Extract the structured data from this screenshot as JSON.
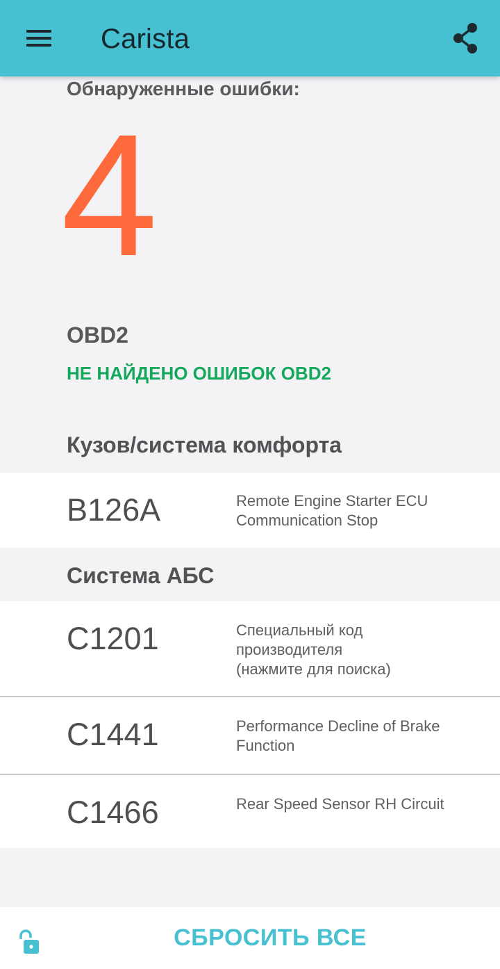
{
  "app": {
    "title": "Carista",
    "menu_icon": "hamburger-menu-icon",
    "share_icon": "share-icon",
    "accent_color": "#47c1d1"
  },
  "summary": {
    "found_label": "Обнаруженные ошибки:",
    "count": "4",
    "count_color": "#ff6a3d"
  },
  "obd": {
    "label": "OBD2",
    "status": "НЕ НАЙДЕНО ОШИБОК OBD2",
    "status_color": "#14a85d"
  },
  "sections": [
    {
      "title": "Кузов/система комфорта",
      "errors": [
        {
          "code": "B126A",
          "description": "Remote Engine Starter ECU\nCommunication Stop"
        }
      ]
    },
    {
      "title": "Система АБС",
      "errors": [
        {
          "code": "C1201",
          "description": "Специальный код\nпроизводителя\n(нажмите для поиска)"
        },
        {
          "code": "C1441",
          "description": "Performance Decline of Brake\nFunction"
        },
        {
          "code": "C1466",
          "description": "Rear Speed Sensor RH Circuit"
        }
      ]
    }
  ],
  "footer": {
    "reset_label": "СБРОСИТЬ ВСЕ",
    "lock_icon": "unlock-icon"
  }
}
